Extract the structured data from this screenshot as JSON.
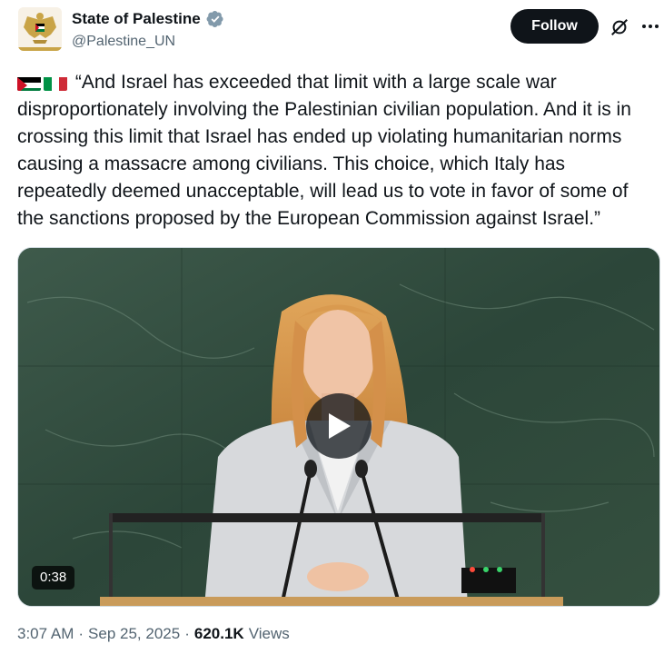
{
  "author": {
    "name": "State of Palestine",
    "handle": "@Palestine_UN",
    "avatar": "palestine-emblem-eagle",
    "verified_icon": "verified-badge-icon",
    "verified_color": "#829aab"
  },
  "actions": {
    "follow_label": "Follow",
    "grok_icon": "grok-icon",
    "more_icon": "more-icon"
  },
  "tweet": {
    "flags": [
      "palestine-flag",
      "italy-flag"
    ],
    "text": "“And Israel has exceeded that limit with a large scale war disproportionately involving the Palestinian civilian population. And it is in crossing this limit that Israel has ended up violating humanitarian norms causing a massacre among civilians. This choice, which Italy has repeatedly deemed unacceptable, will lead us to vote in favor of some of the sanctions proposed by the European Commission against Israel.”"
  },
  "media": {
    "duration": "0:38",
    "play_icon": "play-icon"
  },
  "meta": {
    "time": "3:07 AM",
    "separator": "·",
    "date": "Sep 25, 2025",
    "views_count": "620.1K",
    "views_label": "Views"
  },
  "colors": {
    "text_primary": "#0f1419",
    "text_secondary": "#536471",
    "follow_bg": "#0f1419",
    "palestine_red": "#ce1126",
    "palestine_green": "#007a3d",
    "italy_green": "#009246",
    "italy_red": "#ce2b37"
  }
}
